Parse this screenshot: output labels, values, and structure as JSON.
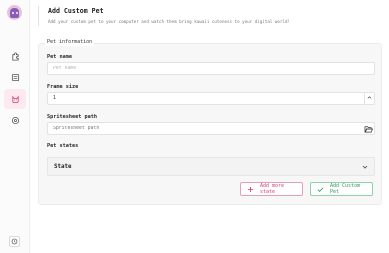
{
  "sidebar": {
    "items": [
      {
        "icon": "puzzle-icon",
        "active": false
      },
      {
        "icon": "list-icon",
        "active": false
      },
      {
        "icon": "cat-icon",
        "active": true
      },
      {
        "icon": "globe-icon",
        "active": false
      }
    ],
    "footer_icon": "history-icon"
  },
  "header": {
    "title": "Add Custom Pet",
    "subtitle": "Add your custom pet to your computer and watch them bring kawaii cuteness to your digital world!"
  },
  "form": {
    "legend": "Pet information",
    "pet_name": {
      "label": "Pet name",
      "placeholder": "Pet name",
      "value": ""
    },
    "frame_size": {
      "label": "Frame size",
      "value": "1"
    },
    "spritesheet": {
      "label": "Spritesheet path",
      "placeholder": "Spritesheet path",
      "value": ""
    },
    "pet_states": {
      "label": "Pet states",
      "dropdown_label": "State"
    },
    "buttons": {
      "add_state": "Add more state",
      "add_pet": "Add Custom Pet"
    }
  },
  "colors": {
    "accent_pink": "#d33f6e",
    "accent_green": "#2f9a5a",
    "active_nav_bg": "#fde9ef"
  }
}
